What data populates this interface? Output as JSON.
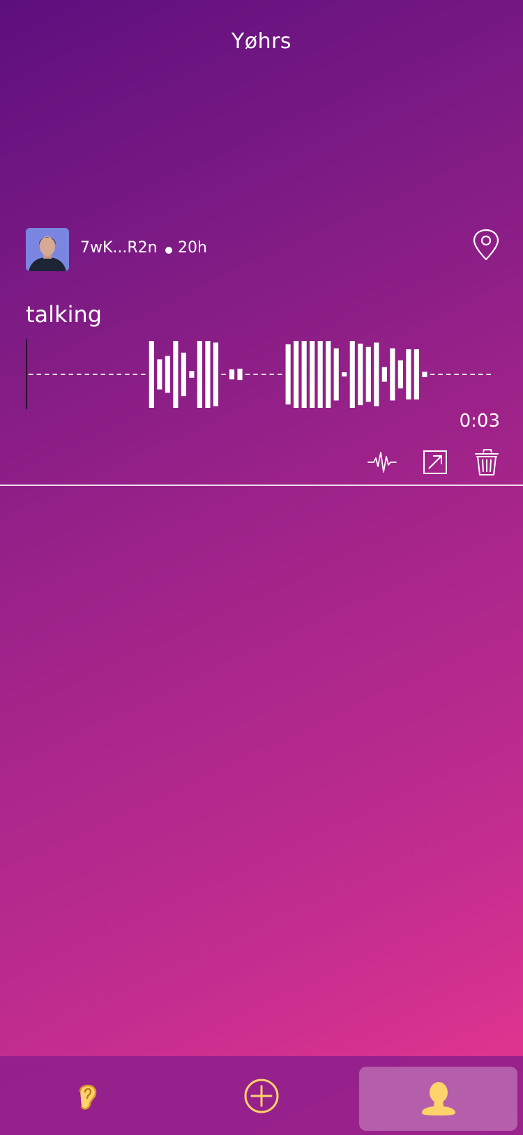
{
  "header": {
    "title": "Yøhrs"
  },
  "post": {
    "username": "7wK...R2n",
    "age": "20h",
    "text": "talking",
    "duration": "0:03",
    "waveform_levels": [
      0.03,
      0.03,
      0.03,
      0.03,
      0.03,
      0.03,
      0.03,
      0.03,
      0.03,
      0.03,
      0.03,
      0.03,
      0.03,
      0.03,
      0.03,
      1.0,
      0.45,
      0.55,
      1.0,
      0.65,
      0.1,
      1.0,
      1.0,
      0.95,
      0.03,
      0.15,
      0.17,
      0.03,
      0.03,
      0.03,
      0.03,
      0.03,
      0.9,
      1.0,
      1.0,
      1.0,
      1.0,
      1.0,
      0.78,
      0.05,
      1.0,
      0.92,
      0.82,
      0.95,
      0.22,
      0.78,
      0.42,
      0.75,
      0.75,
      0.08,
      0.03,
      0.03,
      0.03,
      0.03,
      0.03,
      0.03,
      0.03,
      0.03
    ]
  },
  "actions": {
    "icons": [
      "waveform-icon",
      "share-icon",
      "trash-icon",
      "location-pin-icon"
    ]
  },
  "tabbar": {
    "icons": [
      "ear-icon",
      "add-circle-icon",
      "profile-icon"
    ],
    "accent_color": "#ffd36b",
    "active": "profile"
  },
  "colors": {
    "gradient_start": "#5d0f7e",
    "gradient_end": "#e8378f"
  }
}
